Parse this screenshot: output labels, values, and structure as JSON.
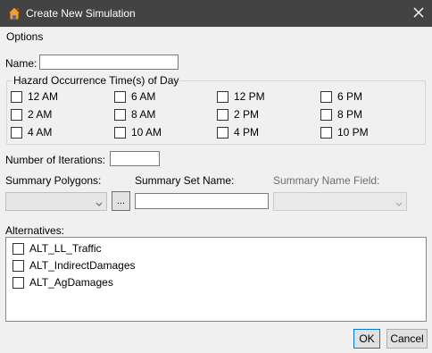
{
  "window": {
    "title": "Create New Simulation",
    "icon": "house-icon",
    "titlebar_color": "#434343"
  },
  "menu": {
    "items": [
      "Options"
    ]
  },
  "name": {
    "label": "Name:",
    "value": ""
  },
  "hazard_group": {
    "legend": "Hazard Occurrence Time(s) of Day",
    "times": [
      [
        "12 AM",
        "6 AM",
        "12 PM",
        "6 PM"
      ],
      [
        "2 AM",
        "8 AM",
        "2 PM",
        "8 PM"
      ],
      [
        "4 AM",
        "10 AM",
        "4 PM",
        "10 PM"
      ]
    ],
    "checked": []
  },
  "iterations": {
    "label": "Number of Iterations:",
    "value": ""
  },
  "summary": {
    "polygons_label": "Summary Polygons:",
    "polygons_value": "",
    "browse_label": "...",
    "set_name_label": "Summary Set Name:",
    "set_name_value": "",
    "name_field_label": "Summary Name Field:",
    "name_field_value": ""
  },
  "alternatives": {
    "label": "Alternatives:",
    "items": [
      "ALT_LL_Traffic",
      "ALT_IndirectDamages",
      "ALT_AgDamages"
    ]
  },
  "buttons": {
    "ok": "OK",
    "cancel": "Cancel"
  }
}
